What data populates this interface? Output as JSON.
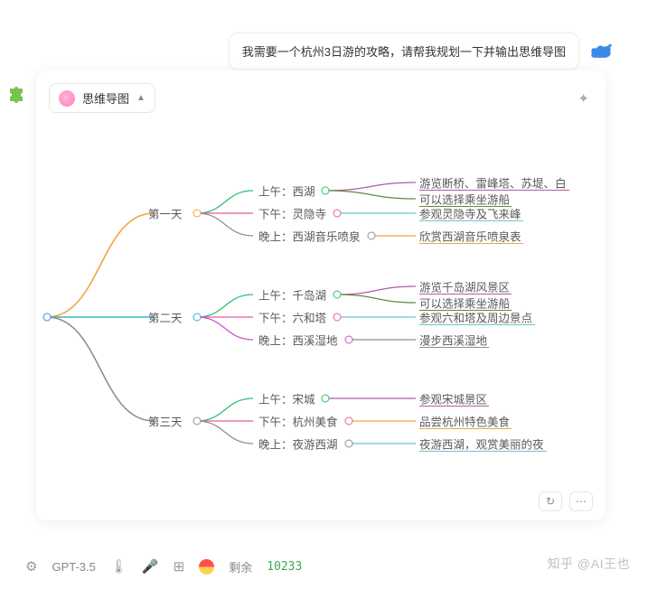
{
  "user_message": "我需要一个杭州3日游的攻略，请帮我规划一下并输出思维导图",
  "chip_label": "思维导图",
  "model": "GPT-3.5",
  "remaining_label": "剩余",
  "remaining_value": "10233",
  "watermark": "知乎 @AI王也",
  "chart_data": {
    "type": "mindmap",
    "root": "",
    "children": [
      {
        "label": "第一天",
        "color": "#f2a33c",
        "children": [
          {
            "label": "上午：西湖",
            "color": "#2fbf71",
            "notes": [
              "游览断桥、雷峰塔、苏堤、白",
              "可以选择乘坐游船"
            ],
            "note_colors": [
              "#b35aa5",
              "#5f8b3c"
            ]
          },
          {
            "label": "下午：灵隐寺",
            "color": "#e85aa1",
            "notes": [
              "参观灵隐寺及飞来峰"
            ],
            "note_colors": [
              "#6cc5c9"
            ]
          },
          {
            "label": "晚上：西湖音乐喷泉",
            "color": "#8f8f8f",
            "notes": [
              "欣赏西湖音乐喷泉表"
            ],
            "note_colors": [
              "#f2a33c"
            ]
          }
        ]
      },
      {
        "label": "第二天",
        "color": "#39b3c7",
        "children": [
          {
            "label": "上午：千岛湖",
            "color": "#2fbf71",
            "notes": [
              "游览千岛湖风景区",
              "可以选择乘坐游船"
            ],
            "note_colors": [
              "#b35aa5",
              "#5f8b3c"
            ]
          },
          {
            "label": "下午：六和塔",
            "color": "#e85aa1",
            "notes": [
              "参观六和塔及周边景点"
            ],
            "note_colors": [
              "#6cc5c9"
            ]
          },
          {
            "label": "晚上：西溪湿地",
            "color": "#c94fd1",
            "notes": [
              "漫步西溪湿地"
            ],
            "note_colors": [
              "#8f8f8f"
            ]
          }
        ]
      },
      {
        "label": "第三天",
        "color": "#8f8f8f",
        "children": [
          {
            "label": "上午：宋城",
            "color": "#2fbf71",
            "notes": [
              "参观宋城景区"
            ],
            "note_colors": [
              "#b35aa5"
            ]
          },
          {
            "label": "下午：杭州美食",
            "color": "#e85aa1",
            "notes": [
              "品尝杭州特色美食"
            ],
            "note_colors": [
              "#f2a33c"
            ]
          },
          {
            "label": "晚上：夜游西湖",
            "color": "#8f8f8f",
            "notes": [
              "夜游西湖，观赏美丽的夜"
            ],
            "note_colors": [
              "#6cc5c9"
            ]
          }
        ]
      }
    ]
  }
}
